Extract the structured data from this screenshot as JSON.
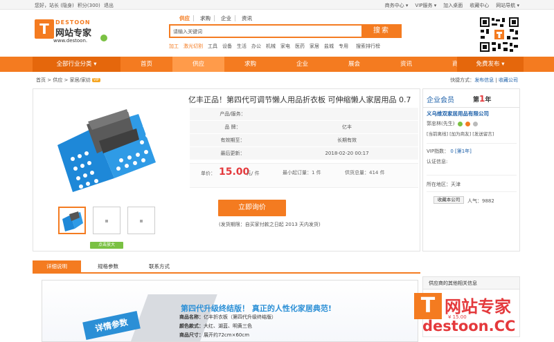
{
  "topbar": {
    "greeting": "您好，站长 (隐身)",
    "credits": "积分(300)",
    "logout": "退出",
    "right_links": [
      "商务中心 ▾",
      "VIP服务 ▾",
      "加入桌面",
      "收藏中心",
      "网站导航 ▾"
    ]
  },
  "logo": {
    "mark": "T",
    "brand_en": "DESTOON",
    "brand_cn": "网站专家",
    "url": "www.destoon."
  },
  "search": {
    "tabs": [
      "供应",
      "求购",
      "企业",
      "资讯"
    ],
    "active_tab": "供应",
    "placeholder": "请输入关键词",
    "button": "搜索",
    "hotwords": [
      "加工",
      "激光切割",
      "工具",
      "设备",
      "生活",
      "办公",
      "机械",
      "家电",
      "医药",
      "家居",
      "盐城",
      "专用"
    ],
    "rank_link": "搜索排行榜"
  },
  "nav": {
    "all_categories": "全部行业分类 ▾",
    "items": [
      "首页",
      "供应",
      "求购",
      "企业",
      "展会",
      "资讯",
      "商城"
    ],
    "active": "供应",
    "publish": "免费发布 ▾"
  },
  "breadcrumb": {
    "text": "首页 > 供应 > 家居/家纺",
    "badge": "VIP"
  },
  "quicknav": {
    "label": "快捷方式：",
    "links": [
      "发布信息",
      "收藏公司"
    ]
  },
  "product": {
    "title": "亿丰正品！第四代可调节懒人用品折衣板 可伸缩懒人家居用品 0.7",
    "attributes": [
      {
        "key": "产品/服务：",
        "value": ""
      },
      {
        "key": "品 牌：",
        "value": "亿丰"
      },
      {
        "key": "有效期至：",
        "value": "长期有效"
      },
      {
        "key": "最后更新：",
        "value": "2018-02-20 00:17"
      }
    ],
    "price_label": "单价：",
    "price": "15.00",
    "price_unit": "元/ 件",
    "min_order": "最小起订量：1 件",
    "total_supply": "供货总量：414 件",
    "inquiry_button": "立即询价",
    "delivery": "(发货期限：自买家付款之日起  2013 天内发货)",
    "zoom_button": "点击放大"
  },
  "member": {
    "heading": "企业会员",
    "rank_prefix": "第",
    "rank_num": "1",
    "rank_suffix": "年",
    "company": "义乌维双家居用品有限公司",
    "person": "郭忠林(先生)",
    "links": "[当前离线] [加为商友] [发送留言]",
    "vip_label": "VIP指数：",
    "vip_value": "0 [第1年]",
    "auth": "认证信息:",
    "area": "所在地区：天津",
    "fav_button": "收藏本公司",
    "popularity": "人气：9882"
  },
  "tabs": [
    "详细说明",
    "规格参数",
    "联系方式"
  ],
  "detail": {
    "banner_label": "详情参数",
    "slogan": "第四代升级终结版！ 真正的人性化家居典范!",
    "lines": [
      {
        "k": "商品名称：",
        "v": "亿丰折衣板（第四代升级终结版）"
      },
      {
        "k": "颜色款式：",
        "v": "大红、湖蓝、明黄三色"
      },
      {
        "k": "商品尺寸：",
        "v": "展开约72cm×60cm"
      }
    ]
  },
  "related": {
    "heading": "供应商的其他相关信息",
    "price": "¥ 15.00"
  },
  "watermark": {
    "mark": "T",
    "cn": "网站专家",
    "en": "destoon.CC"
  },
  "colors": {
    "accent": "#f47b20",
    "link": "#1a5ea8",
    "price": "#e4393c",
    "product_blue": "#2b8fd6"
  }
}
